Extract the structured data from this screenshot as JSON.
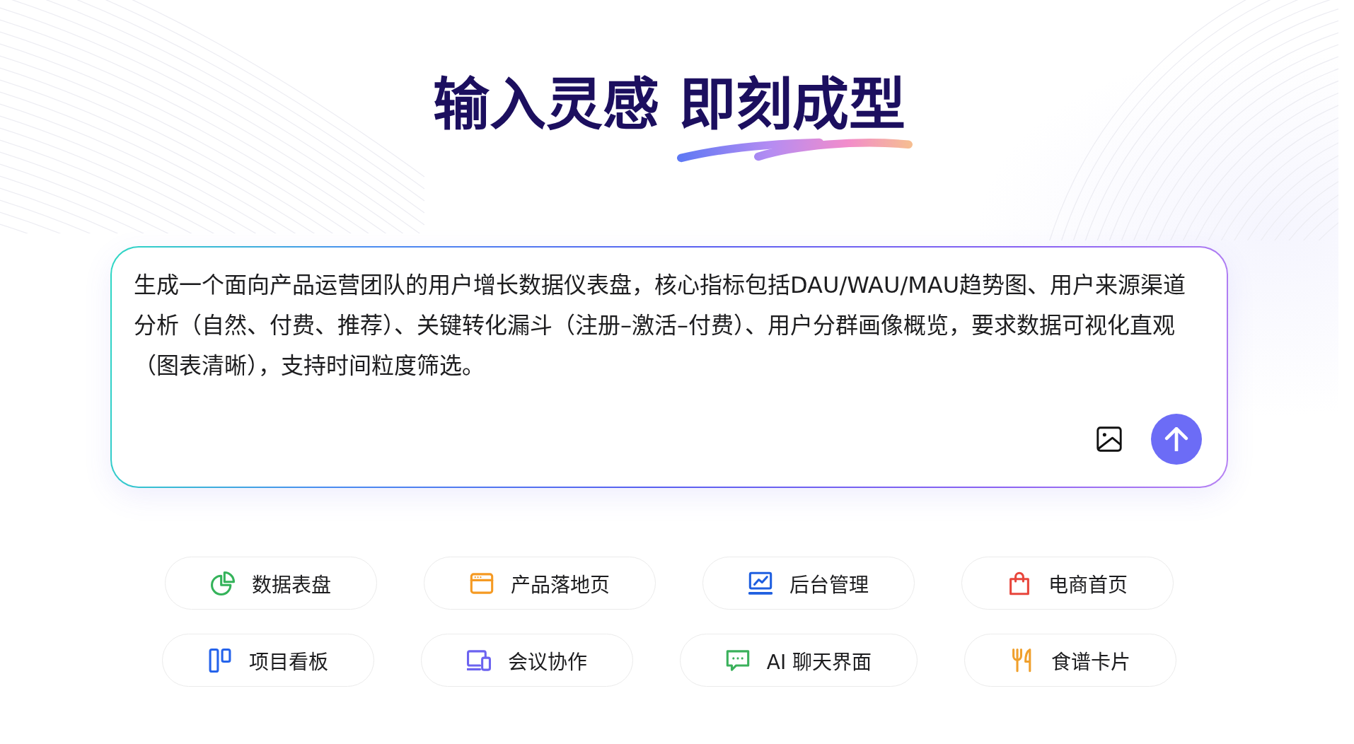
{
  "headline": "输入灵感 即刻成型",
  "prompt": {
    "value": "生成一个面向产品运营团队的用户增长数据仪表盘，核心指标包括DAU/WAU/MAU趋势图、用户来源渠道分析（自然、付费、推荐）、关键转化漏斗（注册–激活–付费）、用户分群画像概览，要求数据可视化直观（图表清晰），支持时间粒度筛选。"
  },
  "suggestions": [
    {
      "label": "数据表盘",
      "kind": "pie",
      "color": "#34b35a"
    },
    {
      "label": "产品落地页",
      "kind": "browser",
      "color": "#f59a23"
    },
    {
      "label": "后台管理",
      "kind": "monitor",
      "color": "#1f5fe0"
    },
    {
      "label": "电商首页",
      "kind": "bag",
      "color": "#e8463c"
    },
    {
      "label": "项目看板",
      "kind": "kanban",
      "color": "#2563eb"
    },
    {
      "label": "会议协作",
      "kind": "devices",
      "color": "#6c63f0"
    },
    {
      "label": "AI 聊天界面",
      "kind": "chat",
      "color": "#3bb15c"
    },
    {
      "label": "食谱卡片",
      "kind": "utensils",
      "color": "#f0a02c"
    }
  ]
}
